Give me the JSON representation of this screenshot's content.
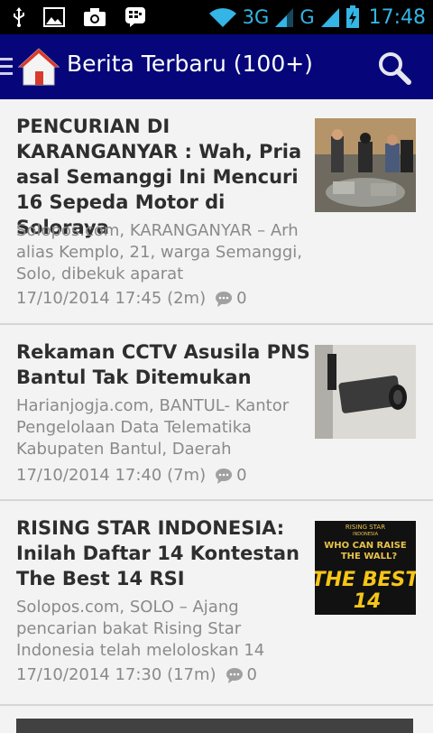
{
  "status_bar": {
    "network_3g": "3G",
    "network_g": "G",
    "time": "17:48",
    "icons": [
      "usb-icon",
      "image-icon",
      "camera-icon",
      "bbm-icon",
      "wifi-icon",
      "signal-icon",
      "battery-charging-icon"
    ]
  },
  "action_bar": {
    "title": "Berita Terbaru (100+)",
    "icons": [
      "menu-icon",
      "home-icon",
      "search-icon"
    ],
    "color": "#06067a"
  },
  "articles": [
    {
      "title": "PENCURIAN DI KARANGANYAR : Wah, Pria asal Semanggi Ini Mencuri 16 Sepeda Motor di Soloraya",
      "summary": "Solopos.com, KARANGANYAR – Arh alias Kemplo, 21, warga Semanggi, Solo, dibekuk aparat",
      "timestamp": "17/10/2014 17:45 (2m)",
      "comments": "0"
    },
    {
      "title": "Rekaman CCTV Asusila PNS Bantul Tak Ditemukan",
      "summary": "Harianjogja.com, BANTUL- Kantor Pengelolaan Data Telematika Kabupaten Bantul, Daerah",
      "timestamp": "17/10/2014 17:40 (7m)",
      "comments": "0"
    },
    {
      "title": "RISING STAR INDONESIA: Inilah Daftar 14 Kontestan The Best 14 RSI",
      "summary": "Solopos.com, SOLO – Ajang pencarian bakat Rising Star Indonesia telah meloloskan 14",
      "timestamp": "17/10/2014 17:30 (17m)",
      "comments": "0",
      "thumb_text": {
        "logo_top": "RISING STAR",
        "logo_sub": "INDONESIA",
        "line1": "WHO CAN RAISE",
        "line2": "THE WALL?",
        "big": "THE BEST",
        "num": "14"
      }
    }
  ]
}
